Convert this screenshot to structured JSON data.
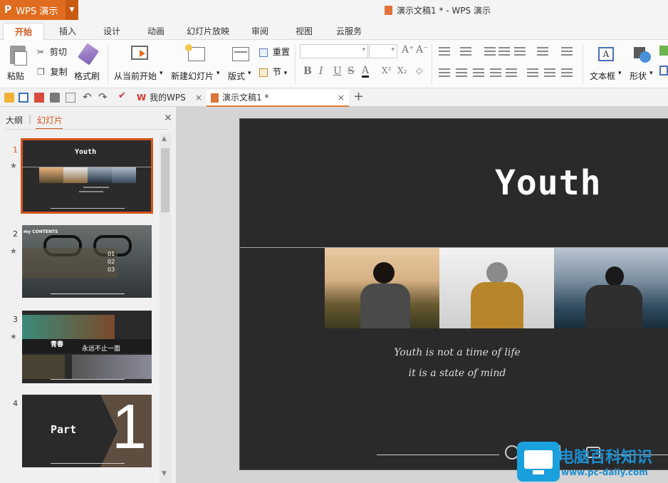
{
  "app": {
    "logo": "P",
    "name": "WPS 演示",
    "window_title": "演示文稿1 * - WPS 演示"
  },
  "ribbon_tabs": [
    "开始",
    "插入",
    "设计",
    "动画",
    "幻灯片放映",
    "审阅",
    "视图",
    "云服务"
  ],
  "ribbon": {
    "paste": "粘贴",
    "cut": "剪切",
    "copy": "复制",
    "format_painter": "格式刷",
    "from_current": "从当前开始",
    "new_slide": "新建幻灯片",
    "layout": "版式",
    "reset": "重置",
    "section": "节",
    "textbox": "文本框",
    "shapes": "形状",
    "bold": "B",
    "italic": "I",
    "underline": "U",
    "strike": "S",
    "font_color": "A",
    "superscript": "X²",
    "subscript": "X₂",
    "grow_font": "A⁺",
    "shrink_font": "A⁻"
  },
  "doc_tabs": [
    {
      "label": "我的WPS",
      "active": false
    },
    {
      "label": "演示文稿1 *",
      "active": true
    }
  ],
  "left_panel": {
    "tabs": [
      "大纲",
      "幻灯片"
    ],
    "active_tab": "幻灯片",
    "separator": "|",
    "slides": [
      {
        "number": "1",
        "title": "Youth",
        "subtitle_1": "Youth is not a time of life",
        "subtitle_2": "it is a state of mind"
      },
      {
        "number": "2",
        "heading": "my CONTENTS",
        "items": [
          "01",
          "02",
          "03"
        ]
      },
      {
        "number": "3",
        "title": "青春",
        "text": "永远不止一面"
      },
      {
        "number": "4",
        "title": "Part",
        "num": "1"
      }
    ]
  },
  "main_slide": {
    "title": "Youth",
    "subtitle_line1": "Youth is not a time of life",
    "subtitle_line2": "it is a state of mind"
  },
  "watermark": {
    "cn": "电脑百科知识",
    "url": "www.pc-daily.com"
  },
  "colors": {
    "accent": "#d2561a",
    "app_orange": "#e06c1f",
    "slide_bg": "#2a2a2a"
  }
}
